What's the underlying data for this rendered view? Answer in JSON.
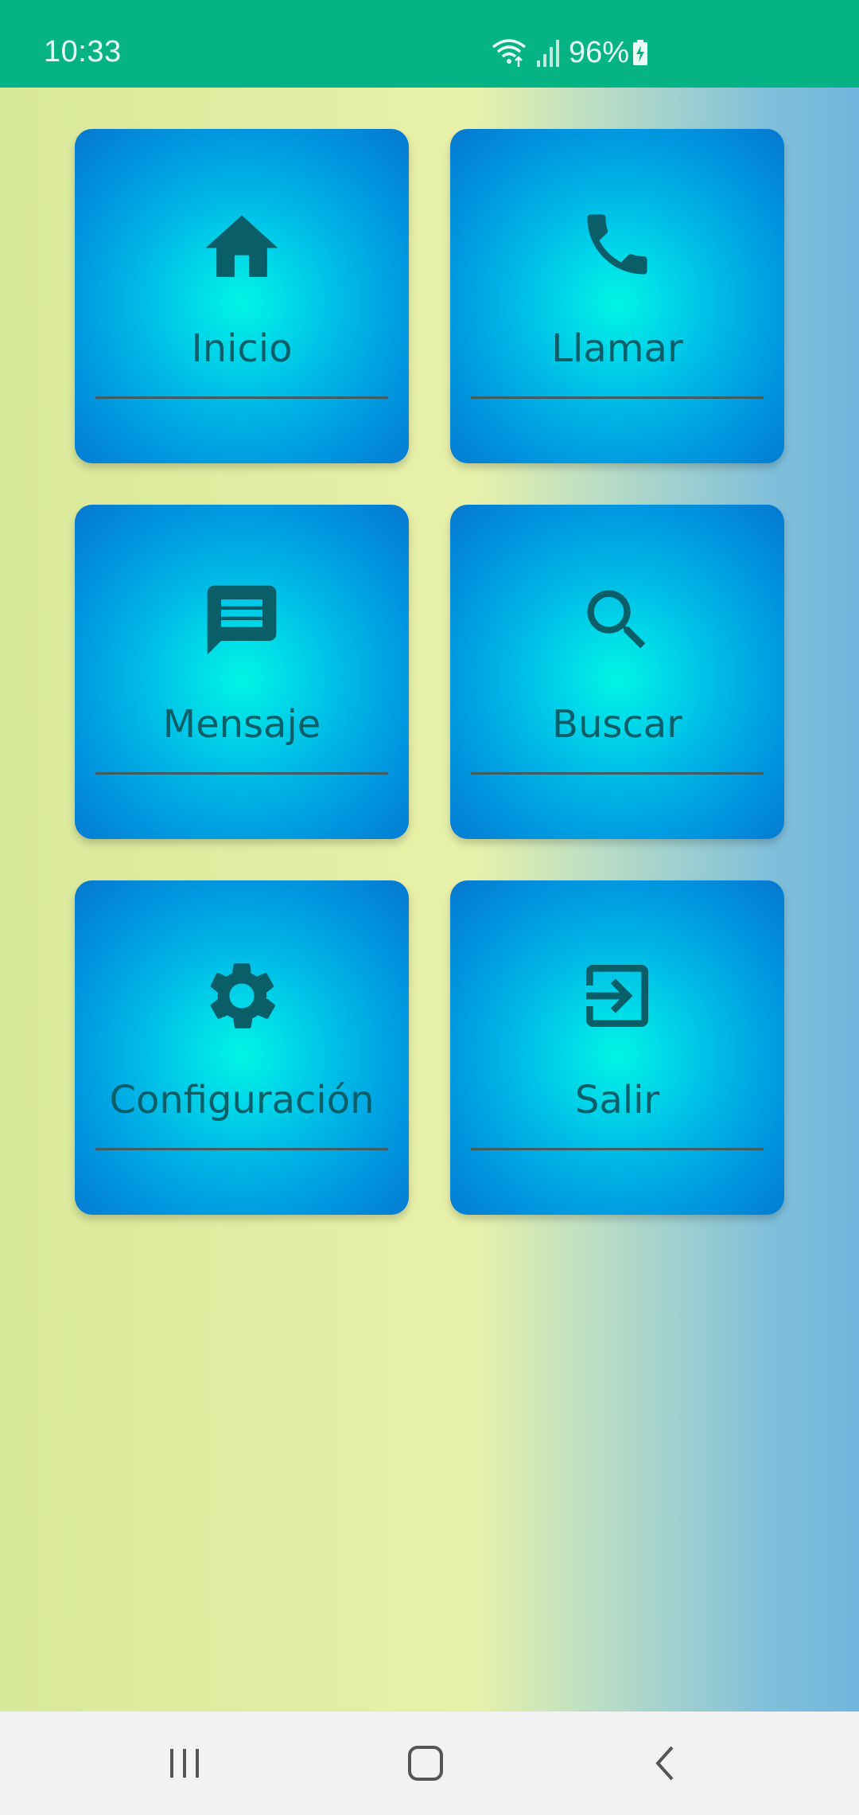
{
  "status_bar": {
    "time": "10:33",
    "battery": "96%",
    "icons": [
      "wifi-icon",
      "signal-icon",
      "battery-charging-icon"
    ],
    "background": "#05b385"
  },
  "grid": {
    "tiles": [
      {
        "label": "Inicio",
        "icon": "home-icon"
      },
      {
        "label": "Llamar",
        "icon": "phone-icon"
      },
      {
        "label": "Mensaje",
        "icon": "message-icon"
      },
      {
        "label": "Buscar",
        "icon": "search-icon"
      },
      {
        "label": "Configuración",
        "icon": "settings-icon"
      },
      {
        "label": "Salir",
        "icon": "exit-icon"
      }
    ],
    "accent": "#0a5e68"
  },
  "nav_bar": {
    "buttons": [
      "recent-apps-icon",
      "home-nav-icon",
      "back-icon"
    ]
  }
}
